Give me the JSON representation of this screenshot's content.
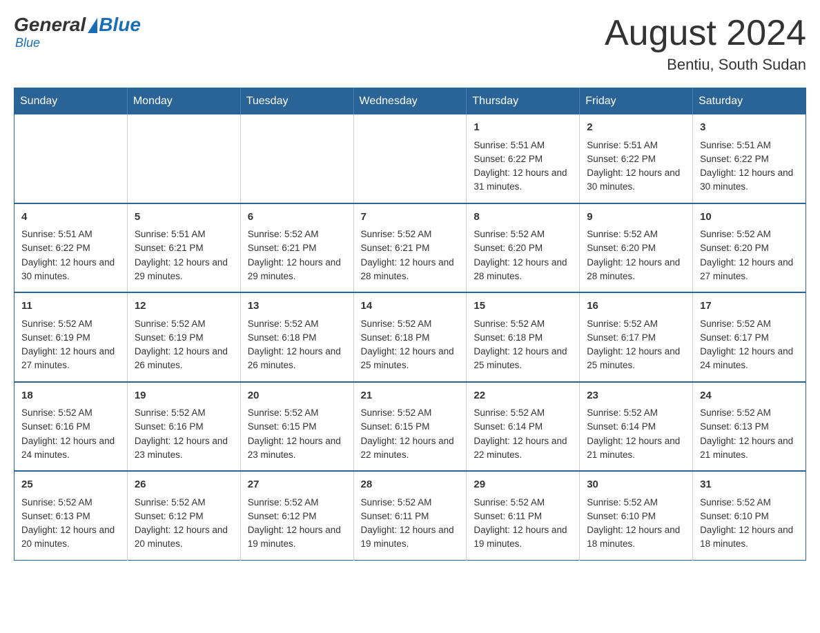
{
  "logo": {
    "general": "General",
    "blue": "Blue"
  },
  "title": "August 2024",
  "location": "Bentiu, South Sudan",
  "days_of_week": [
    "Sunday",
    "Monday",
    "Tuesday",
    "Wednesday",
    "Thursday",
    "Friday",
    "Saturday"
  ],
  "weeks": [
    [
      {
        "day": "",
        "sunrise": "",
        "sunset": "",
        "daylight": ""
      },
      {
        "day": "",
        "sunrise": "",
        "sunset": "",
        "daylight": ""
      },
      {
        "day": "",
        "sunrise": "",
        "sunset": "",
        "daylight": ""
      },
      {
        "day": "",
        "sunrise": "",
        "sunset": "",
        "daylight": ""
      },
      {
        "day": "1",
        "sunrise": "Sunrise: 5:51 AM",
        "sunset": "Sunset: 6:22 PM",
        "daylight": "Daylight: 12 hours and 31 minutes."
      },
      {
        "day": "2",
        "sunrise": "Sunrise: 5:51 AM",
        "sunset": "Sunset: 6:22 PM",
        "daylight": "Daylight: 12 hours and 30 minutes."
      },
      {
        "day": "3",
        "sunrise": "Sunrise: 5:51 AM",
        "sunset": "Sunset: 6:22 PM",
        "daylight": "Daylight: 12 hours and 30 minutes."
      }
    ],
    [
      {
        "day": "4",
        "sunrise": "Sunrise: 5:51 AM",
        "sunset": "Sunset: 6:22 PM",
        "daylight": "Daylight: 12 hours and 30 minutes."
      },
      {
        "day": "5",
        "sunrise": "Sunrise: 5:51 AM",
        "sunset": "Sunset: 6:21 PM",
        "daylight": "Daylight: 12 hours and 29 minutes."
      },
      {
        "day": "6",
        "sunrise": "Sunrise: 5:52 AM",
        "sunset": "Sunset: 6:21 PM",
        "daylight": "Daylight: 12 hours and 29 minutes."
      },
      {
        "day": "7",
        "sunrise": "Sunrise: 5:52 AM",
        "sunset": "Sunset: 6:21 PM",
        "daylight": "Daylight: 12 hours and 28 minutes."
      },
      {
        "day": "8",
        "sunrise": "Sunrise: 5:52 AM",
        "sunset": "Sunset: 6:20 PM",
        "daylight": "Daylight: 12 hours and 28 minutes."
      },
      {
        "day": "9",
        "sunrise": "Sunrise: 5:52 AM",
        "sunset": "Sunset: 6:20 PM",
        "daylight": "Daylight: 12 hours and 28 minutes."
      },
      {
        "day": "10",
        "sunrise": "Sunrise: 5:52 AM",
        "sunset": "Sunset: 6:20 PM",
        "daylight": "Daylight: 12 hours and 27 minutes."
      }
    ],
    [
      {
        "day": "11",
        "sunrise": "Sunrise: 5:52 AM",
        "sunset": "Sunset: 6:19 PM",
        "daylight": "Daylight: 12 hours and 27 minutes."
      },
      {
        "day": "12",
        "sunrise": "Sunrise: 5:52 AM",
        "sunset": "Sunset: 6:19 PM",
        "daylight": "Daylight: 12 hours and 26 minutes."
      },
      {
        "day": "13",
        "sunrise": "Sunrise: 5:52 AM",
        "sunset": "Sunset: 6:18 PM",
        "daylight": "Daylight: 12 hours and 26 minutes."
      },
      {
        "day": "14",
        "sunrise": "Sunrise: 5:52 AM",
        "sunset": "Sunset: 6:18 PM",
        "daylight": "Daylight: 12 hours and 25 minutes."
      },
      {
        "day": "15",
        "sunrise": "Sunrise: 5:52 AM",
        "sunset": "Sunset: 6:18 PM",
        "daylight": "Daylight: 12 hours and 25 minutes."
      },
      {
        "day": "16",
        "sunrise": "Sunrise: 5:52 AM",
        "sunset": "Sunset: 6:17 PM",
        "daylight": "Daylight: 12 hours and 25 minutes."
      },
      {
        "day": "17",
        "sunrise": "Sunrise: 5:52 AM",
        "sunset": "Sunset: 6:17 PM",
        "daylight": "Daylight: 12 hours and 24 minutes."
      }
    ],
    [
      {
        "day": "18",
        "sunrise": "Sunrise: 5:52 AM",
        "sunset": "Sunset: 6:16 PM",
        "daylight": "Daylight: 12 hours and 24 minutes."
      },
      {
        "day": "19",
        "sunrise": "Sunrise: 5:52 AM",
        "sunset": "Sunset: 6:16 PM",
        "daylight": "Daylight: 12 hours and 23 minutes."
      },
      {
        "day": "20",
        "sunrise": "Sunrise: 5:52 AM",
        "sunset": "Sunset: 6:15 PM",
        "daylight": "Daylight: 12 hours and 23 minutes."
      },
      {
        "day": "21",
        "sunrise": "Sunrise: 5:52 AM",
        "sunset": "Sunset: 6:15 PM",
        "daylight": "Daylight: 12 hours and 22 minutes."
      },
      {
        "day": "22",
        "sunrise": "Sunrise: 5:52 AM",
        "sunset": "Sunset: 6:14 PM",
        "daylight": "Daylight: 12 hours and 22 minutes."
      },
      {
        "day": "23",
        "sunrise": "Sunrise: 5:52 AM",
        "sunset": "Sunset: 6:14 PM",
        "daylight": "Daylight: 12 hours and 21 minutes."
      },
      {
        "day": "24",
        "sunrise": "Sunrise: 5:52 AM",
        "sunset": "Sunset: 6:13 PM",
        "daylight": "Daylight: 12 hours and 21 minutes."
      }
    ],
    [
      {
        "day": "25",
        "sunrise": "Sunrise: 5:52 AM",
        "sunset": "Sunset: 6:13 PM",
        "daylight": "Daylight: 12 hours and 20 minutes."
      },
      {
        "day": "26",
        "sunrise": "Sunrise: 5:52 AM",
        "sunset": "Sunset: 6:12 PM",
        "daylight": "Daylight: 12 hours and 20 minutes."
      },
      {
        "day": "27",
        "sunrise": "Sunrise: 5:52 AM",
        "sunset": "Sunset: 6:12 PM",
        "daylight": "Daylight: 12 hours and 19 minutes."
      },
      {
        "day": "28",
        "sunrise": "Sunrise: 5:52 AM",
        "sunset": "Sunset: 6:11 PM",
        "daylight": "Daylight: 12 hours and 19 minutes."
      },
      {
        "day": "29",
        "sunrise": "Sunrise: 5:52 AM",
        "sunset": "Sunset: 6:11 PM",
        "daylight": "Daylight: 12 hours and 19 minutes."
      },
      {
        "day": "30",
        "sunrise": "Sunrise: 5:52 AM",
        "sunset": "Sunset: 6:10 PM",
        "daylight": "Daylight: 12 hours and 18 minutes."
      },
      {
        "day": "31",
        "sunrise": "Sunrise: 5:52 AM",
        "sunset": "Sunset: 6:10 PM",
        "daylight": "Daylight: 12 hours and 18 minutes."
      }
    ]
  ]
}
